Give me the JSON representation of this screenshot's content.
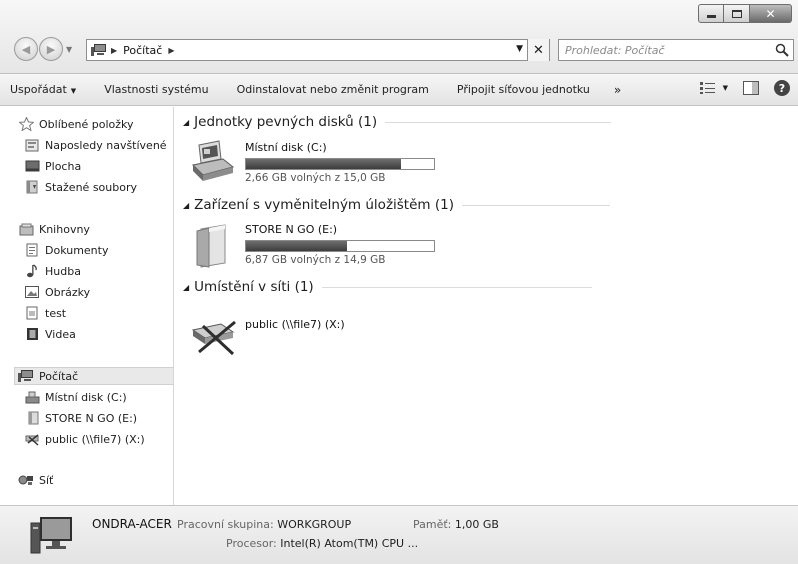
{
  "window": {
    "controls": {
      "minimize_icon": "minimize-icon",
      "maximize_icon": "maximize-icon",
      "close_icon": "close-icon"
    }
  },
  "address_bar": {
    "breadcrumb": [
      "Počítač"
    ],
    "search_placeholder": "Prohledat: Počítač"
  },
  "toolbar": {
    "items": [
      {
        "label": "Uspořádat",
        "has_dropdown": true
      },
      {
        "label": "Vlastnosti systému"
      },
      {
        "label": "Odinstalovat nebo změnit program"
      },
      {
        "label": "Připojit síťovou jednotku"
      }
    ],
    "overflow_label": "»"
  },
  "sidebar": {
    "favorites": {
      "label": "Oblíbené položky",
      "items": [
        "Naposledy navštívené",
        "Plocha",
        "Stažené soubory"
      ]
    },
    "libraries": {
      "label": "Knihovny",
      "items": [
        "Dokumenty",
        "Hudba",
        "Obrázky",
        "test",
        "Videa"
      ]
    },
    "computer": {
      "label": "Počítač",
      "items": [
        "Místní disk (C:)",
        "STORE N GO (E:)",
        "public (\\\\file7) (X:)"
      ]
    },
    "network": {
      "label": "Síť"
    }
  },
  "main": {
    "groups": [
      {
        "title": "Jednotky pevných disků (1)",
        "drives": [
          {
            "name": "Místní disk (C:)",
            "free_text": "2,66 GB volných z 15,0 GB",
            "used_fraction": 0.823
          }
        ]
      },
      {
        "title": "Zařízení s vyměnitelným úložištěm (1)",
        "drives": [
          {
            "name": "STORE N GO (E:)",
            "free_text": "6,87 GB volných z 14,9 GB",
            "used_fraction": 0.539
          }
        ]
      },
      {
        "title": "Umístění v síti (1)",
        "drives": [
          {
            "name": "public (\\\\file7) (X:)"
          }
        ]
      }
    ]
  },
  "details": {
    "computer_name": "ONDRA-ACER",
    "workgroup_label": "Pracovní skupina:",
    "workgroup_value": "WORKGROUP",
    "memory_label": "Paměť:",
    "memory_value": "1,00 GB",
    "processor_label": "Procesor:",
    "processor_value": "Intel(R) Atom(TM) CPU ..."
  },
  "colors": {
    "selection_bg": "#e9e9e9",
    "bar_fill": "#4a4a4a"
  }
}
